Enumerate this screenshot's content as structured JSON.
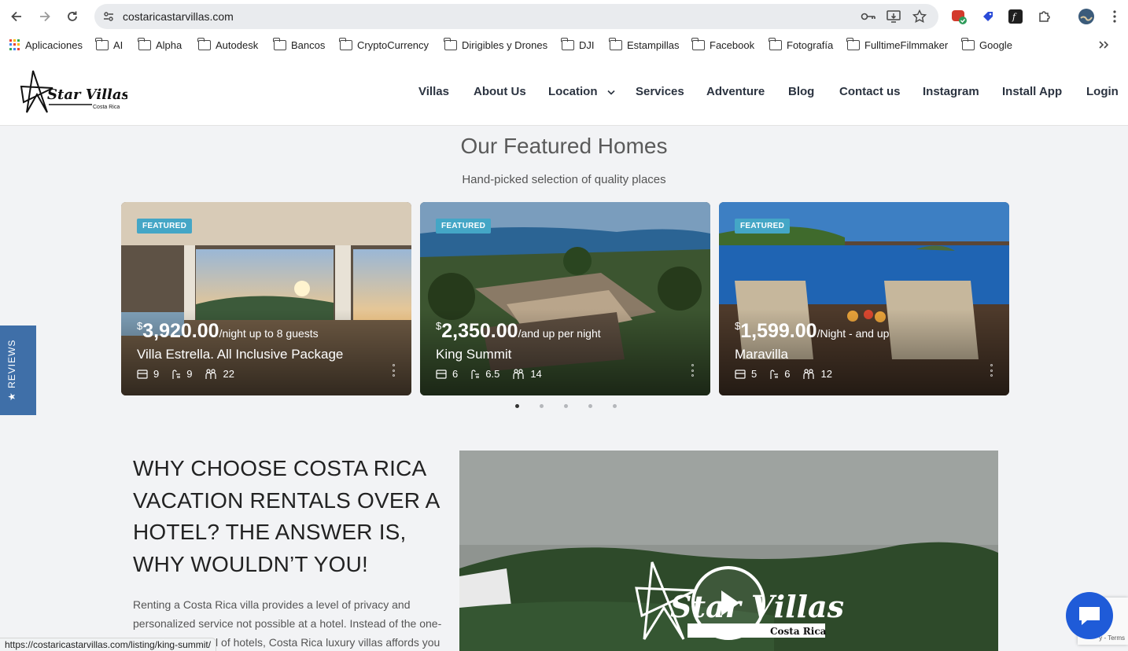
{
  "browser": {
    "url": "costaricastarvillas.com",
    "status_url": "https://costaricastarvillas.com/listing/king-summit/"
  },
  "bookmarks": [
    {
      "label": "Aplicaciones",
      "icon": "apps-grid-icon"
    },
    {
      "label": "AI",
      "icon": "folder-icon"
    },
    {
      "label": "Alpha",
      "icon": "folder-icon"
    },
    {
      "label": "Autodesk",
      "icon": "folder-icon"
    },
    {
      "label": "Bancos",
      "icon": "folder-icon"
    },
    {
      "label": "CryptoCurrency",
      "icon": "folder-icon"
    },
    {
      "label": "Dirigibles y Drones",
      "icon": "folder-icon"
    },
    {
      "label": "DJI",
      "icon": "folder-icon"
    },
    {
      "label": "Estampillas",
      "icon": "folder-icon"
    },
    {
      "label": "Facebook",
      "icon": "folder-icon"
    },
    {
      "label": "Fotografía",
      "icon": "folder-icon"
    },
    {
      "label": "FulltimeFilmmaker",
      "icon": "folder-icon"
    },
    {
      "label": "Google",
      "icon": "folder-icon"
    }
  ],
  "site": {
    "logo": {
      "name": "Star Villas",
      "sub": "Costa Rica"
    },
    "nav": [
      "Villas",
      "About Us",
      "Location",
      "Services",
      "Adventure",
      "Blog",
      "Contact us",
      "Instagram",
      "Install App",
      "Login"
    ]
  },
  "featured": {
    "title": "Our Featured Homes",
    "subtitle": "Hand-picked selection of quality places",
    "badge": "FEATURED",
    "cards": [
      {
        "currency": "$",
        "amount": "3,920.00",
        "per": "/night up to 8 guests",
        "name": "Villa Estrella. All Inclusive Package",
        "beds": "9",
        "baths": "9",
        "guests": "22"
      },
      {
        "currency": "$",
        "amount": "2,350.00",
        "per": "/and up per night",
        "name": "King Summit",
        "beds": "6",
        "baths": "6.5",
        "guests": "14"
      },
      {
        "currency": "$",
        "amount": "1,599.00",
        "per": "/Night - and up",
        "name": "Maravilla",
        "beds": "5",
        "baths": "6",
        "guests": "12"
      }
    ],
    "pagination": {
      "count": 5,
      "active": 1
    }
  },
  "reviews_tab": "★ REVIEWS",
  "why": {
    "title": "WHY CHOOSE COSTA RICA VACATION RENTALS OVER A HOTEL? THE ANSWER IS, WHY WOULDN’T YOU!",
    "body": "Renting a Costa Rica villa provides a level of privacy and personalized service not possible at a hotel. Instead of the one-size-fits-all model of hotels, Costa Rica luxury villas affords you"
  },
  "video": {
    "logo_name": "Star Villas",
    "logo_sub": "Costa Rica"
  },
  "recaptcha": {
    "terms": "y - Terms"
  },
  "colors": {
    "badge": "#44a6c6",
    "reviews_tab": "#3f6fa8",
    "chat": "#1f5bd8"
  }
}
